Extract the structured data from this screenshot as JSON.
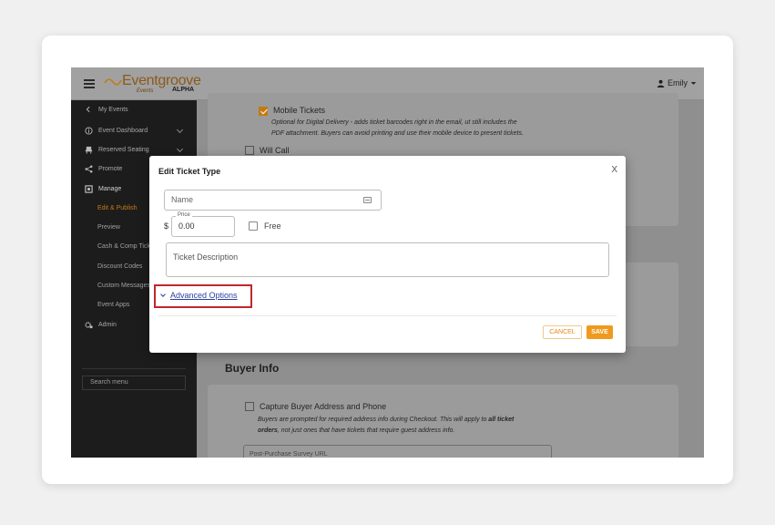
{
  "brand": {
    "name": "Eventgroove",
    "sub": "Events",
    "badge": "ALPHA",
    "color": "#c47a14"
  },
  "user": {
    "name": "Emily"
  },
  "sidebar": {
    "items": [
      {
        "label": "My Events",
        "icon": "chevron-left-icon"
      },
      {
        "label": "Event Dashboard",
        "icon": "info-icon"
      },
      {
        "label": "Reserved Seating",
        "icon": "seat-icon"
      },
      {
        "label": "Promote",
        "icon": "share-icon"
      },
      {
        "label": "Manage",
        "icon": "manage-icon"
      }
    ],
    "sub_items": [
      {
        "label": "Edit & Publish",
        "active": true
      },
      {
        "label": "Preview"
      },
      {
        "label": "Cash & Comp Tickets"
      },
      {
        "label": "Discount Codes"
      },
      {
        "label": "Custom Messages"
      },
      {
        "label": "Event Apps"
      }
    ],
    "admin": {
      "label": "Admin",
      "icon": "gears-icon"
    },
    "search_placeholder": "Search menu"
  },
  "background": {
    "mobile_tickets": {
      "label": "Mobile Tickets",
      "checked": true,
      "desc1": "Optional for Digital Delivery - adds ticket barcodes right in the email, ut still includes the",
      "desc2": "PDF attachment. Buyers can avoid printing and use their mobile device to present tickets."
    },
    "will_call": {
      "label": "Will Call",
      "checked": false
    },
    "buyer_info_title": "Buyer Info",
    "capture_address": {
      "label": "Capture Buyer Address and Phone",
      "desc_a": "Buyers are prompted for required address info during Checkout. This will apply to ",
      "desc_b": "all ticket",
      "desc_c": "orders",
      "desc_d": ", not just ones that have tickets that require guest address info."
    },
    "survey_placeholder": "Post-Purchase Survey URL"
  },
  "modal": {
    "title": "Edit Ticket Type",
    "close": "X",
    "name_placeholder": "Name",
    "price_label": "Price",
    "currency": "$",
    "price_value": "0.00",
    "free_label": "Free",
    "description_placeholder": "Ticket Description",
    "advanced_label": "Advanced Options",
    "cancel_label": "CANCEL",
    "save_label": "SAVE",
    "highlight_color": "#c0272d"
  }
}
